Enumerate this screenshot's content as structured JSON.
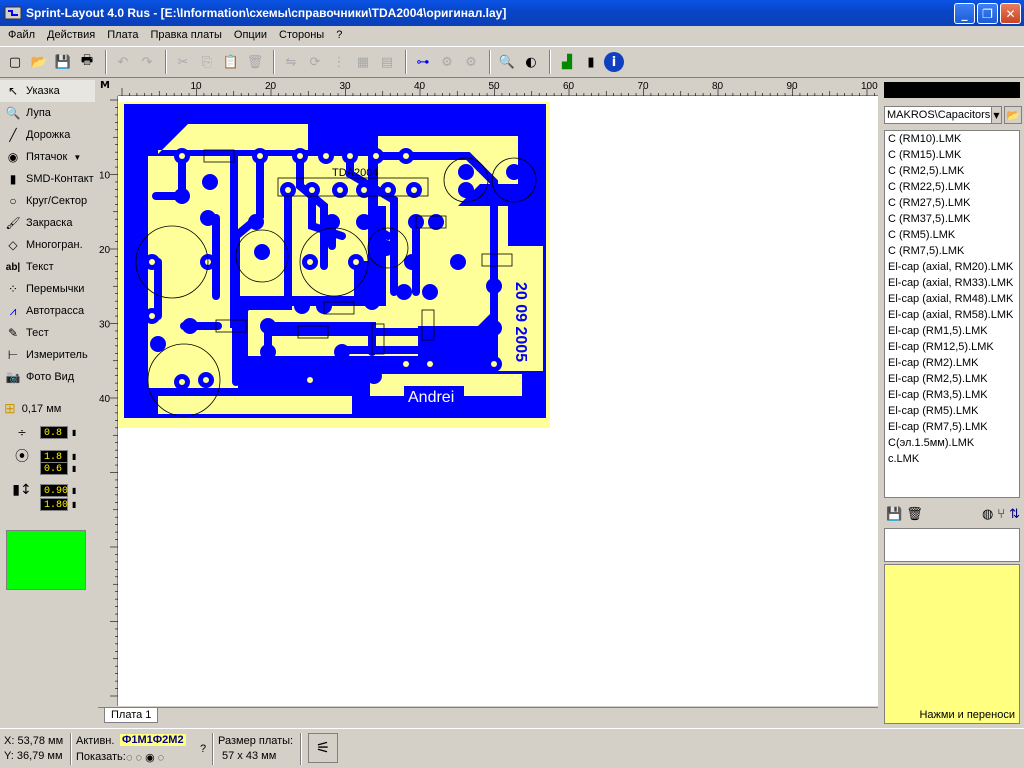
{
  "window": {
    "title": "Sprint-Layout 4.0 Rus - [E:\\Information\\схемы\\справочники\\TDA2004\\оригинал.lay]",
    "min": "_",
    "max": "❐",
    "close": "✕"
  },
  "menu": [
    "Файл",
    "Действия",
    "Плата",
    "Правка платы",
    "Опции",
    "Стороны",
    "?"
  ],
  "toolbar": {
    "icons": [
      "new-icon",
      "open-icon",
      "save-icon",
      "print-icon",
      "undo-icon",
      "redo-icon",
      "cut-icon",
      "copy-icon",
      "paste-icon",
      "delete-icon",
      "mirror-icon",
      "rotate-icon",
      "align-icon",
      "group-icon",
      "ungroup-icon",
      "measure-icon",
      "search-icon",
      "contrast-icon",
      "drc-icon",
      "component-icon",
      "info-icon"
    ]
  },
  "tools": [
    {
      "label": "Указка",
      "icon": "pointer-icon"
    },
    {
      "label": "Лупа",
      "icon": "zoom-icon"
    },
    {
      "label": "Дорожка",
      "icon": "track-icon"
    },
    {
      "label": "Пятачок",
      "icon": "pad-icon"
    },
    {
      "label": "SMD-Контакт",
      "icon": "smd-icon"
    },
    {
      "label": "Круг/Сектор",
      "icon": "circle-icon"
    },
    {
      "label": "Закраска",
      "icon": "fill-icon"
    },
    {
      "label": "Многогран.",
      "icon": "polygon-icon"
    },
    {
      "label": "Текст",
      "icon": "text-icon"
    },
    {
      "label": "Перемычки",
      "icon": "jumper-icon"
    },
    {
      "label": "Автотрасса",
      "icon": "autoroute-icon"
    },
    {
      "label": "Тест",
      "icon": "test-icon"
    },
    {
      "label": "Измеритель",
      "icon": "measure-icon"
    },
    {
      "label": "Фото Вид",
      "icon": "photo-icon"
    }
  ],
  "grid": {
    "value": "0,17 мм"
  },
  "params": {
    "track_width": "0.8",
    "pad_outer": "1.8",
    "pad_inner": "0.6",
    "smd_w": "0.90",
    "smd_h": "1.80"
  },
  "colors": {
    "board_fill": "#ffff99",
    "copper": "#0000ff",
    "layer": "#00ff00",
    "canvas": "#ffffff"
  },
  "ruler": {
    "unit": "M",
    "top_ticks": [
      "10",
      "20",
      "30",
      "40",
      "50",
      "60",
      "70",
      "80",
      "90",
      "100"
    ],
    "left_ticks": [
      "10",
      "20",
      "30",
      "40"
    ]
  },
  "board": {
    "chip_label": "TDA2004",
    "author": "Andrei",
    "date": "20 09 2005"
  },
  "tabs": {
    "active": "Плата 1"
  },
  "library": {
    "selected": "MAKROS\\Capacitors",
    "items": [
      "C (RM10).LMK",
      "C (RM15).LMK",
      "C (RM2,5).LMK",
      "C (RM22,5).LMK",
      "C (RM27,5).LMK",
      "C (RM37,5).LMK",
      "C (RM5).LMK",
      "C (RM7,5).LMK",
      "El-cap (axial, RM20).LMK",
      "El-cap (axial, RM33).LMK",
      "El-cap (axial, RM48).LMK",
      "El-cap (axial, RM58).LMK",
      "El-cap (RM1,5).LMK",
      "El-cap (RM12,5).LMK",
      "El-cap (RM2).LMK",
      "El-cap (RM2,5).LMK",
      "El-cap (RM3,5).LMK",
      "El-cap (RM5).LMK",
      "El-cap (RM7,5).LMK",
      "C(эл.1.5мм).LMK",
      "c.LMK"
    ],
    "hint": "Нажми и переноси"
  },
  "status": {
    "x": "X: 53,78 мм",
    "y": "Y: 36,79 мм",
    "active_label": "Активн.",
    "layers": "Ф1М1Ф2М2",
    "show_label": "Показать:",
    "help": "?",
    "size_label": "Размер платы:",
    "size_value": "57 x 43 мм"
  }
}
